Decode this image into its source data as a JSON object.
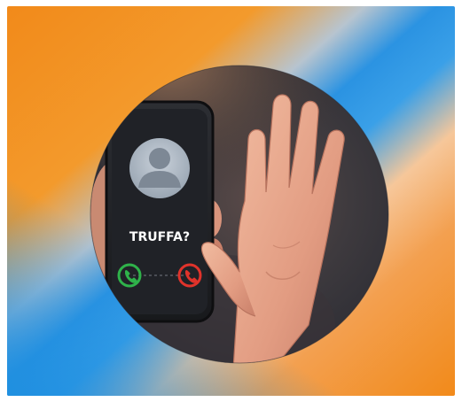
{
  "caption": "TRUFFA?",
  "icons": {
    "caller": "user-silhouette-icon",
    "accept": "phone-accept-icon",
    "decline": "phone-decline-icon"
  },
  "colors": {
    "orange": "#f28a1a",
    "blue": "#1f8fe0",
    "peach": "#f6c79a",
    "accept_green": "#2fb24a",
    "decline_red": "#e0332b",
    "skin": "#e9a98e"
  }
}
